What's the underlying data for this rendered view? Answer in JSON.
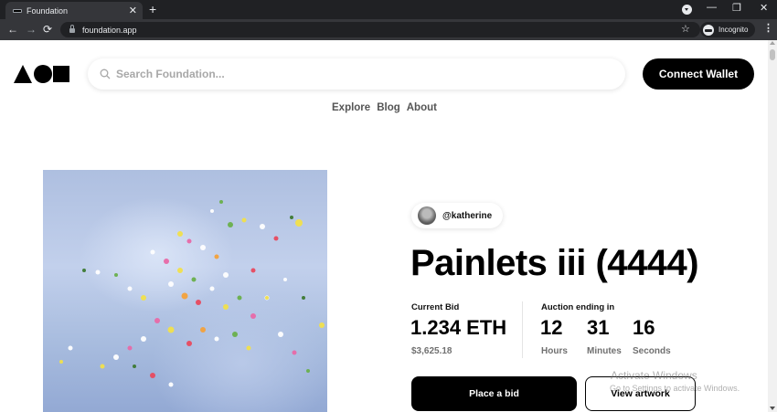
{
  "browser": {
    "tab_title": "Foundation",
    "tab_close": "✕",
    "new_tab": "+",
    "url": "foundation.app",
    "incognito_label": "Incognito",
    "nav": {
      "back": "←",
      "forward": "→",
      "reload": "⟳"
    },
    "bookmark": "☆",
    "menu": "⋮",
    "window": {
      "minimize": "—",
      "maximize": "❐",
      "close": "✕"
    }
  },
  "header": {
    "search_placeholder": "Search Foundation...",
    "connect_label": "Connect Wallet",
    "nav_links": [
      "Explore",
      "Blog",
      "About"
    ]
  },
  "artwork": {
    "creator": "@katherine",
    "title": "Painlets iii (4444)"
  },
  "auction": {
    "current_bid_label": "Current Bid",
    "current_bid": "1.234 ETH",
    "current_bid_usd": "$3,625.18",
    "ending_label": "Auction ending in",
    "hours": "12",
    "hours_label": "Hours",
    "minutes": "31",
    "minutes_label": "Minutes",
    "seconds": "16",
    "seconds_label": "Seconds"
  },
  "actions": {
    "place_bid": "Place a bid",
    "view_artwork": "View artwork"
  },
  "watermark": {
    "line1": "Activate Windows",
    "line2": "Go to Settings to activate Windows."
  },
  "colors": {
    "chrome_dark": "#202124",
    "chrome_tab": "#35363a",
    "primary_button": "#000000",
    "muted_text": "#707070"
  }
}
